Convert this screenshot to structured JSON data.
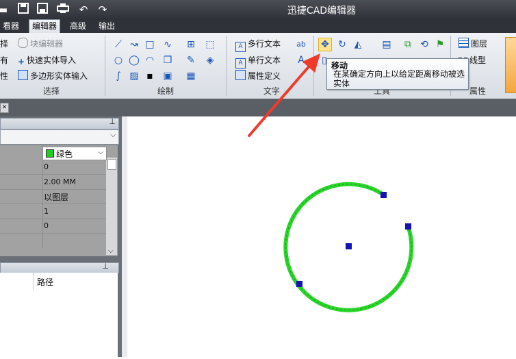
{
  "titlebar": {
    "title": "迅捷CAD编辑器",
    "icons": [
      "folder-icon",
      "save-icon",
      "save-as-icon",
      "print-icon",
      "undo-icon",
      "redo-icon"
    ]
  },
  "tabs": [
    {
      "label": "看器",
      "active": false
    },
    {
      "label": "编辑器",
      "active": true
    },
    {
      "label": "高级",
      "active": false
    },
    {
      "label": "输出",
      "active": false
    }
  ],
  "ribbon": {
    "select_group": {
      "label": "选择",
      "items": [
        "择",
        "有",
        "性"
      ],
      "block_editor": "块编辑器",
      "quick_import": "快速实体导入",
      "polygon_input": "多边形实体输入"
    },
    "draw_group": {
      "label": "绘制"
    },
    "text_group": {
      "label": "文字",
      "mtext": "多行文本",
      "stext": "单行文本",
      "attdef": "属性定义"
    },
    "tools_group": {
      "label": "工具"
    },
    "props_group": {
      "label": "属性",
      "layers": "图层",
      "linetype": "线型"
    }
  },
  "tooltip": {
    "title": "移动",
    "description": "在某确定方向上以给定距离移动被选实体"
  },
  "properties": {
    "color": "绿色",
    "color_hex": "#22cc22",
    "values": [
      "0",
      "2.00 MM",
      "以图层",
      "1",
      "0"
    ]
  },
  "path_panel": {
    "header": "路径"
  },
  "colors": {
    "arc": "#2bd62b",
    "grip": "#1414b4",
    "arrow": "#ef3b2c"
  }
}
